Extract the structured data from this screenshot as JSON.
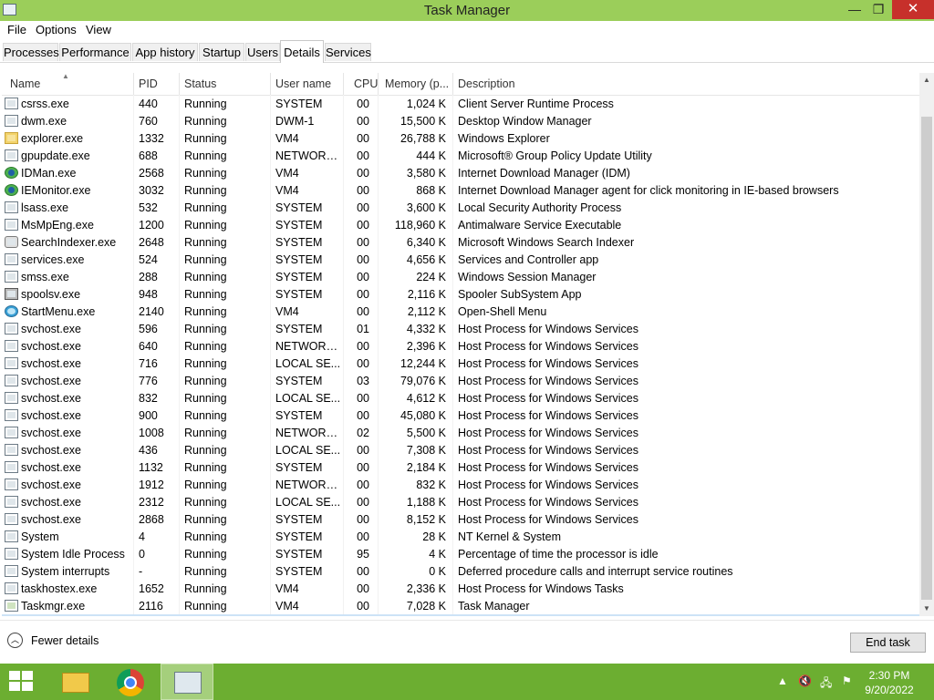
{
  "window": {
    "title": "Task Manager",
    "minimize": "—",
    "maximize": "❐",
    "close": "✕"
  },
  "menu": [
    "File",
    "Options",
    "View"
  ],
  "tabs": [
    "Processes",
    "Performance",
    "App history",
    "Startup",
    "Users",
    "Details",
    "Services"
  ],
  "active_tab": "Details",
  "columns": {
    "name": "Name",
    "pid": "PID",
    "status": "Status",
    "user": "User name",
    "cpu": "CPU",
    "memory": "Memory (p...",
    "description": "Description"
  },
  "rows": [
    {
      "icon": "app-icon",
      "name": "csrss.exe",
      "pid": "440",
      "status": "Running",
      "user": "SYSTEM",
      "cpu": "00",
      "memory": "1,024 K",
      "description": "Client Server Runtime Process"
    },
    {
      "icon": "app-icon",
      "name": "dwm.exe",
      "pid": "760",
      "status": "Running",
      "user": "DWM-1",
      "cpu": "00",
      "memory": "15,500 K",
      "description": "Desktop Window Manager"
    },
    {
      "icon": "folder-icon",
      "name": "explorer.exe",
      "pid": "1332",
      "status": "Running",
      "user": "VM4",
      "cpu": "00",
      "memory": "26,788 K",
      "description": "Windows Explorer"
    },
    {
      "icon": "app-icon",
      "name": "gpupdate.exe",
      "pid": "688",
      "status": "Running",
      "user": "NETWORK...",
      "cpu": "00",
      "memory": "444 K",
      "description": "Microsoft® Group Policy Update Utility"
    },
    {
      "icon": "globe-icon",
      "name": "IDMan.exe",
      "pid": "2568",
      "status": "Running",
      "user": "VM4",
      "cpu": "00",
      "memory": "3,580 K",
      "description": "Internet Download Manager (IDM)"
    },
    {
      "icon": "globe-icon",
      "name": "IEMonitor.exe",
      "pid": "3032",
      "status": "Running",
      "user": "VM4",
      "cpu": "00",
      "memory": "868 K",
      "description": "Internet Download Manager agent for click monitoring in IE-based browsers"
    },
    {
      "icon": "app-icon",
      "name": "lsass.exe",
      "pid": "532",
      "status": "Running",
      "user": "SYSTEM",
      "cpu": "00",
      "memory": "3,600 K",
      "description": "Local Security Authority Process"
    },
    {
      "icon": "app-icon",
      "name": "MsMpEng.exe",
      "pid": "1200",
      "status": "Running",
      "user": "SYSTEM",
      "cpu": "00",
      "memory": "118,960 K",
      "description": "Antimalware Service Executable"
    },
    {
      "icon": "person-icon",
      "name": "SearchIndexer.exe",
      "pid": "2648",
      "status": "Running",
      "user": "SYSTEM",
      "cpu": "00",
      "memory": "6,340 K",
      "description": "Microsoft Windows Search Indexer"
    },
    {
      "icon": "app-icon",
      "name": "services.exe",
      "pid": "524",
      "status": "Running",
      "user": "SYSTEM",
      "cpu": "00",
      "memory": "4,656 K",
      "description": "Services and Controller app"
    },
    {
      "icon": "app-icon",
      "name": "smss.exe",
      "pid": "288",
      "status": "Running",
      "user": "SYSTEM",
      "cpu": "00",
      "memory": "224 K",
      "description": "Windows Session Manager"
    },
    {
      "icon": "printer-icon",
      "name": "spoolsv.exe",
      "pid": "948",
      "status": "Running",
      "user": "SYSTEM",
      "cpu": "00",
      "memory": "2,116 K",
      "description": "Spooler SubSystem App"
    },
    {
      "icon": "shell-icon",
      "name": "StartMenu.exe",
      "pid": "2140",
      "status": "Running",
      "user": "VM4",
      "cpu": "00",
      "memory": "2,112 K",
      "description": "Open-Shell Menu"
    },
    {
      "icon": "app-icon",
      "name": "svchost.exe",
      "pid": "596",
      "status": "Running",
      "user": "SYSTEM",
      "cpu": "01",
      "memory": "4,332 K",
      "description": "Host Process for Windows Services"
    },
    {
      "icon": "app-icon",
      "name": "svchost.exe",
      "pid": "640",
      "status": "Running",
      "user": "NETWORK...",
      "cpu": "00",
      "memory": "2,396 K",
      "description": "Host Process for Windows Services"
    },
    {
      "icon": "app-icon",
      "name": "svchost.exe",
      "pid": "716",
      "status": "Running",
      "user": "LOCAL SE...",
      "cpu": "00",
      "memory": "12,244 K",
      "description": "Host Process for Windows Services"
    },
    {
      "icon": "app-icon",
      "name": "svchost.exe",
      "pid": "776",
      "status": "Running",
      "user": "SYSTEM",
      "cpu": "03",
      "memory": "79,076 K",
      "description": "Host Process for Windows Services"
    },
    {
      "icon": "app-icon",
      "name": "svchost.exe",
      "pid": "832",
      "status": "Running",
      "user": "LOCAL SE...",
      "cpu": "00",
      "memory": "4,612 K",
      "description": "Host Process for Windows Services"
    },
    {
      "icon": "app-icon",
      "name": "svchost.exe",
      "pid": "900",
      "status": "Running",
      "user": "SYSTEM",
      "cpu": "00",
      "memory": "45,080 K",
      "description": "Host Process for Windows Services"
    },
    {
      "icon": "app-icon",
      "name": "svchost.exe",
      "pid": "1008",
      "status": "Running",
      "user": "NETWORK...",
      "cpu": "02",
      "memory": "5,500 K",
      "description": "Host Process for Windows Services"
    },
    {
      "icon": "app-icon",
      "name": "svchost.exe",
      "pid": "436",
      "status": "Running",
      "user": "LOCAL SE...",
      "cpu": "00",
      "memory": "7,308 K",
      "description": "Host Process for Windows Services"
    },
    {
      "icon": "app-icon",
      "name": "svchost.exe",
      "pid": "1132",
      "status": "Running",
      "user": "SYSTEM",
      "cpu": "00",
      "memory": "2,184 K",
      "description": "Host Process for Windows Services"
    },
    {
      "icon": "app-icon",
      "name": "svchost.exe",
      "pid": "1912",
      "status": "Running",
      "user": "NETWORK...",
      "cpu": "00",
      "memory": "832 K",
      "description": "Host Process for Windows Services"
    },
    {
      "icon": "app-icon",
      "name": "svchost.exe",
      "pid": "2312",
      "status": "Running",
      "user": "LOCAL SE...",
      "cpu": "00",
      "memory": "1,188 K",
      "description": "Host Process for Windows Services"
    },
    {
      "icon": "app-icon",
      "name": "svchost.exe",
      "pid": "2868",
      "status": "Running",
      "user": "SYSTEM",
      "cpu": "00",
      "memory": "8,152 K",
      "description": "Host Process for Windows Services"
    },
    {
      "icon": "app-icon",
      "name": "System",
      "pid": "4",
      "status": "Running",
      "user": "SYSTEM",
      "cpu": "00",
      "memory": "28 K",
      "description": "NT Kernel & System"
    },
    {
      "icon": "app-icon",
      "name": "System Idle Process",
      "pid": "0",
      "status": "Running",
      "user": "SYSTEM",
      "cpu": "95",
      "memory": "4 K",
      "description": "Percentage of time the processor is idle"
    },
    {
      "icon": "app-icon",
      "name": "System interrupts",
      "pid": "-",
      "status": "Running",
      "user": "SYSTEM",
      "cpu": "00",
      "memory": "0 K",
      "description": "Deferred procedure calls and interrupt service routines"
    },
    {
      "icon": "app-icon",
      "name": "taskhostex.exe",
      "pid": "1652",
      "status": "Running",
      "user": "VM4",
      "cpu": "00",
      "memory": "2,336 K",
      "description": "Host Process for Windows Tasks"
    },
    {
      "icon": "chart-icon",
      "name": "Taskmgr.exe",
      "pid": "2116",
      "status": "Running",
      "user": "VM4",
      "cpu": "00",
      "memory": "7,028 K",
      "description": "Task Manager"
    }
  ],
  "footer": {
    "fewer_details": "Fewer details",
    "end_task": "End task"
  },
  "taskbar": {
    "time": "2:30 PM",
    "date": "9/20/2022"
  }
}
